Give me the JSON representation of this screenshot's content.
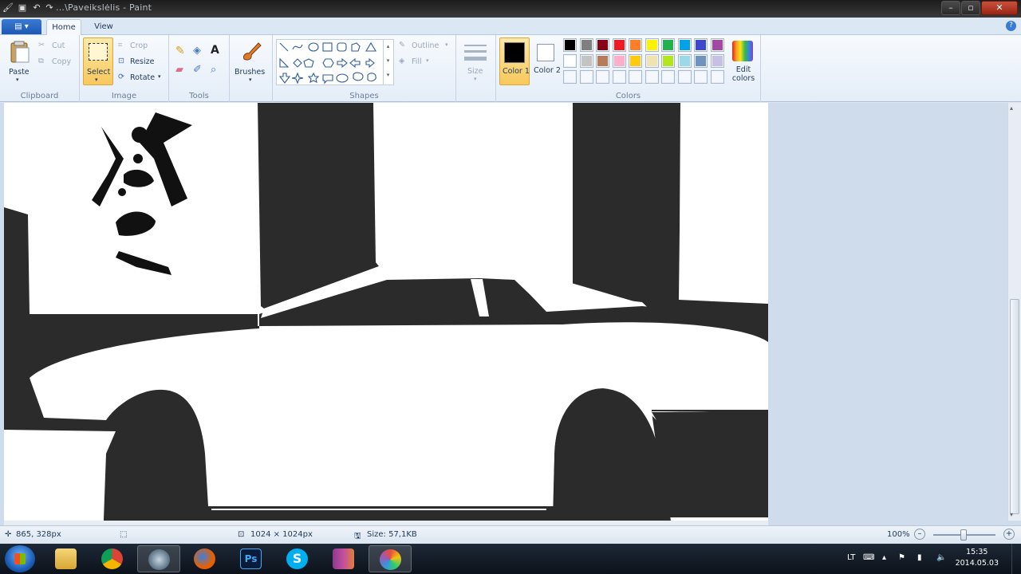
{
  "window": {
    "title": "...\\Paveikslėlis - Paint"
  },
  "tabs": {
    "app_menu": "▾",
    "items": [
      {
        "label": "Home"
      },
      {
        "label": "View"
      }
    ],
    "active": "Home"
  },
  "ribbon": {
    "clipboard": {
      "label": "Clipboard",
      "paste": "Paste",
      "cut": "Cut",
      "copy": "Copy"
    },
    "image": {
      "label": "Image",
      "select": "Select",
      "crop": "Crop",
      "resize": "Resize",
      "rotate": "Rotate"
    },
    "tools": {
      "label": "Tools"
    },
    "brushes": {
      "label": "Brushes"
    },
    "shapes": {
      "label": "Shapes",
      "outline": "Outline",
      "fill": "Fill"
    },
    "size": {
      "label": "Size"
    },
    "colors": {
      "label": "Colors",
      "color1": "Color 1",
      "color1_value": "#000000",
      "color2": "Color 2",
      "color2_value": "#ffffff",
      "edit": "Edit colors",
      "row1": [
        "#000000",
        "#7f7f7f",
        "#880015",
        "#ed1c24",
        "#ff7f27",
        "#fff200",
        "#22b14c",
        "#00a2e8",
        "#3f48cc",
        "#a349a4"
      ],
      "row2": [
        "#ffffff",
        "#c3c3c3",
        "#b97a57",
        "#ffaec9",
        "#ffc90e",
        "#efe4b0",
        "#b5e61d",
        "#99d9ea",
        "#7092be",
        "#c8bfe7"
      ]
    }
  },
  "status": {
    "cursor": "865, 328px",
    "dimensions": "1024 × 1024px",
    "size": "Size: 57,1KB",
    "zoom": "100%"
  },
  "taskbar": {
    "apps": [
      {
        "name": "start",
        "icon": "windows-orb"
      },
      {
        "name": "explorer",
        "icon": "folder-icon"
      },
      {
        "name": "chrome",
        "icon": "chrome-icon"
      },
      {
        "name": "steam",
        "icon": "steam-icon"
      },
      {
        "name": "firefox",
        "icon": "firefox-icon"
      },
      {
        "name": "photoshop",
        "icon": "photoshop-icon",
        "text": "Ps"
      },
      {
        "name": "skype",
        "icon": "skype-icon",
        "text": "S"
      },
      {
        "name": "winrar",
        "icon": "archive-icon"
      },
      {
        "name": "paint",
        "icon": "paint-icon"
      }
    ],
    "tray": {
      "language": "LT",
      "time": "15:35",
      "date": "2014.05.03"
    }
  }
}
